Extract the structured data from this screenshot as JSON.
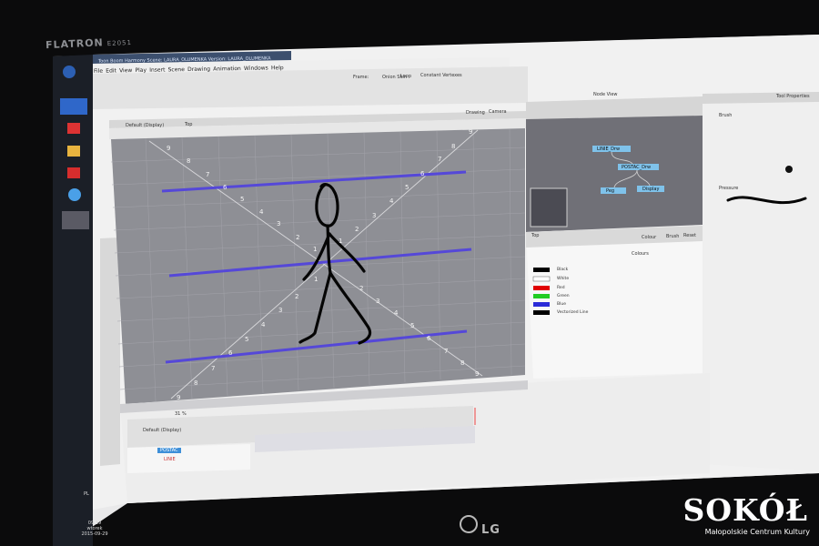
{
  "monitor": {
    "brand": "FLATRON",
    "model": "E2051",
    "logo": "LG"
  },
  "watermark": {
    "title": "SOKÓŁ",
    "subtitle": "Małopolskie Centrum Kultury"
  },
  "app": {
    "title": "Toon Boom Harmony Scene: LAURA_OLUMENKA Version: LAURA_OLUMENKA",
    "menu": [
      "File",
      "Edit",
      "View",
      "Play",
      "Insert",
      "Scene",
      "Drawing",
      "Animation",
      "Windows",
      "Help"
    ],
    "toolbar_fields": [
      "Frame:",
      "Onion Skin",
      "Loop",
      "Constant Vertexes"
    ],
    "camera_tabs": [
      "Drawing",
      "Camera"
    ],
    "view_dropdown": "Default (Display)",
    "view_label": "Top",
    "zoom": "31 %",
    "node_view": {
      "title": "Node View",
      "nodes": [
        "LINIE_Drw",
        "POSTAC_Drw",
        "Peg",
        "Display"
      ]
    },
    "color_view": {
      "tabs": [
        "Top",
        "Colour",
        "Brush",
        "Reset",
        "Colours"
      ],
      "swatches": [
        {
          "name": "Black",
          "color": "#000000"
        },
        {
          "name": "White",
          "color": "#ffffff"
        },
        {
          "name": "Red",
          "color": "#e00000"
        },
        {
          "name": "Green",
          "color": "#22cc22"
        },
        {
          "name": "Blue",
          "color": "#2b2bd8"
        },
        {
          "name": "Vectorized Line",
          "color": "#000000"
        }
      ]
    },
    "timeline": {
      "view_dropdown": "Default (Display)",
      "layers": [
        "POSTAC",
        "LINIE"
      ]
    },
    "tool_properties": {
      "title": "Tool Properties",
      "brush_label": "Brush",
      "stroke_label": "Pressure"
    }
  },
  "canvas": {
    "background": "#8f8f94",
    "guide_numbers": [
      "1",
      "2",
      "3",
      "4",
      "5",
      "6",
      "7",
      "8",
      "9"
    ],
    "line_color": "#5548d8"
  },
  "taskbar": {
    "language": "PL",
    "time": "09:19",
    "day": "wtorek",
    "date": "2015-09-29"
  }
}
